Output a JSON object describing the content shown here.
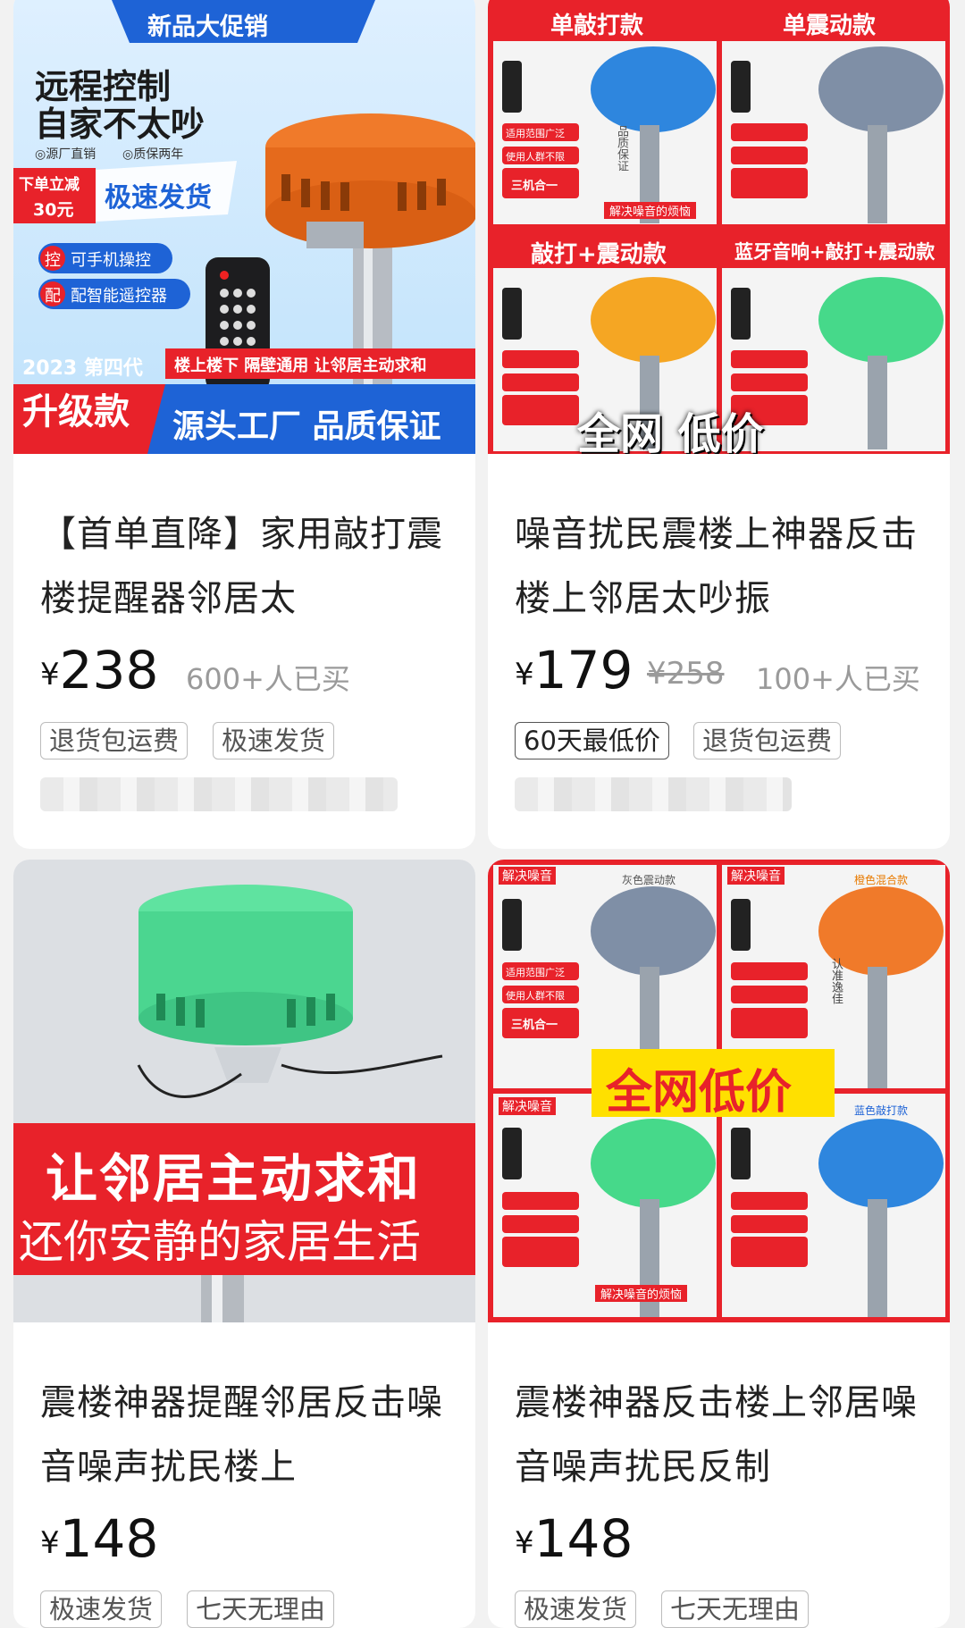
{
  "products": [
    {
      "title": "【首单直降】家用敲打震楼提醒器邻居太",
      "price_symbol": "¥",
      "price": "238",
      "sold": "600+人已买",
      "tags": [
        "退货包运费",
        "极速发货"
      ],
      "image_text": {
        "banner": "新品大促销",
        "headline_1": "远程控制",
        "headline_2": "自家不太吵",
        "bullet_1": "◎源厂直销",
        "bullet_2": "◎质保两年",
        "discount_1": "下单立减",
        "discount_2": "30元",
        "fast": "极速发货",
        "feature_1_icon": "控",
        "feature_1": "可手机操控",
        "feature_2_icon": "配",
        "feature_2": "配智能遥控器",
        "year": "2023 第四代",
        "upgrade": "升级款",
        "strip": "楼上楼下 隔壁通用 让邻居主动求和",
        "footer": "源头工厂 品质保证"
      }
    },
    {
      "title": "噪音扰民震楼上神器反击楼上邻居太吵振",
      "price_symbol": "¥",
      "price": "179",
      "original_price": "¥258",
      "sold": "100+人已买",
      "tags": [
        "60天最低价",
        "退货包运费"
      ],
      "image_text": {
        "q1": "单敲打款",
        "q2": "单震动款",
        "q3": "敲打+震动款",
        "q4": "蓝牙音响+敲打+震动款",
        "overlay": "全网 低价",
        "row1": "适用范围广泛",
        "row2": "使用人群不限",
        "row3": "三机合一",
        "side": "品质保证",
        "bottom": "解决噪音的烦恼"
      }
    },
    {
      "title": "震楼神器提醒邻居反击噪音噪声扰民楼上",
      "price_symbol": "¥",
      "price": "148",
      "tags": [
        "极速发货",
        "七天无理由"
      ],
      "image_text": {
        "line_1": "让邻居主动求和",
        "line_2": "还你安静的家居生活"
      }
    },
    {
      "title": "震楼神器反击楼上邻居噪音噪声扰民反制",
      "price_symbol": "¥",
      "price": "148",
      "tags": [
        "极速发货",
        "七天无理由"
      ],
      "image_text": {
        "q1": "解决噪音",
        "q1_label": "灰色震动款",
        "q2": "解决噪音",
        "q2_label": "橙色混合款",
        "q3": "解决噪音",
        "q4_label": "蓝色敲打款",
        "overlay": "全网低价",
        "row1": "适用范围广泛",
        "row2": "使用人群不限",
        "row3": "三机合一",
        "side": "认准逸佳",
        "bottom": "解决噪音的烦恼"
      }
    }
  ],
  "colors": {
    "red": "#e8222a",
    "blue": "#1e63d6",
    "orange": "#f07a2a",
    "green": "#46d98a",
    "gray_device": "#7f8fa6"
  }
}
